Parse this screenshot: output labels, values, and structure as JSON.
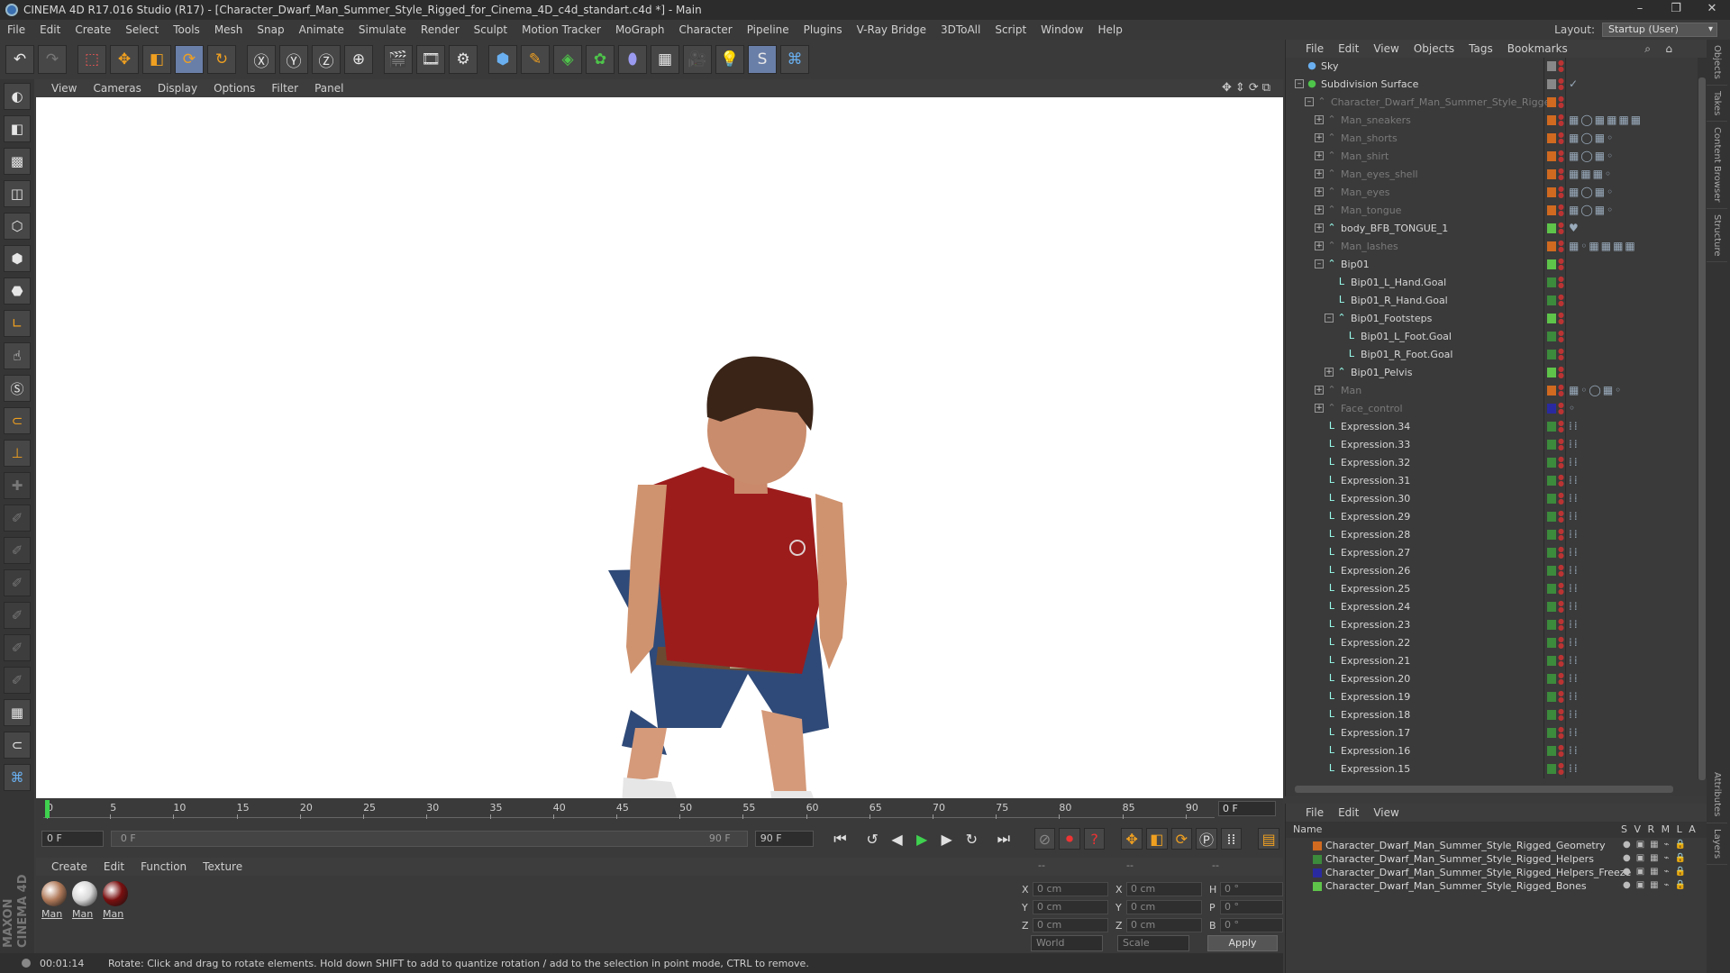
{
  "window": {
    "title": "CINEMA 4D R17.016 Studio (R17) - [Character_Dwarf_Man_Summer_Style_Rigged_for_Cinema_4D_c4d_standart.c4d *] - Main"
  },
  "menu": [
    "File",
    "Edit",
    "Create",
    "Select",
    "Tools",
    "Mesh",
    "Snap",
    "Animate",
    "Simulate",
    "Render",
    "Sculpt",
    "Motion Tracker",
    "MoGraph",
    "Character",
    "Pipeline",
    "Plugins",
    "V-Ray Bridge",
    "3DToAll",
    "Script",
    "Window",
    "Help"
  ],
  "layout": {
    "label": "Layout:",
    "value": "Startup (User)"
  },
  "viewport_menu": [
    "View",
    "Cameras",
    "Display",
    "Options",
    "Filter",
    "Panel"
  ],
  "timeline": {
    "ticks": [
      "0",
      "5",
      "10",
      "15",
      "20",
      "25",
      "30",
      "35",
      "40",
      "45",
      "50",
      "55",
      "60",
      "65",
      "70",
      "75",
      "80",
      "85",
      "90"
    ],
    "current_frame": "0 F"
  },
  "transport": {
    "start": "0 F",
    "range_start": "0 F",
    "range_end": "90 F",
    "end": "90 F"
  },
  "material_menu": [
    "Create",
    "Edit",
    "Function",
    "Texture"
  ],
  "materials": [
    {
      "name": "Man",
      "color": "#b07a5a"
    },
    {
      "name": "Man",
      "color": "#d8d8d8"
    },
    {
      "name": "Man",
      "color": "#7a1010"
    }
  ],
  "coords": {
    "rows": [
      {
        "a1": "X",
        "v1": "0 cm",
        "a2": "X",
        "v2": "0 cm",
        "a3": "H",
        "v3": "0 °"
      },
      {
        "a1": "Y",
        "v1": "0 cm",
        "a2": "Y",
        "v2": "0 cm",
        "a3": "P",
        "v3": "0 °"
      },
      {
        "a1": "Z",
        "v1": "0 cm",
        "a2": "Z",
        "v2": "0 cm",
        "a3": "B",
        "v3": "0 °"
      }
    ],
    "mode": "World",
    "scale": "Scale",
    "apply": "Apply",
    "header_left": "--",
    "header_mid": "--",
    "header_right": "--"
  },
  "status": {
    "time": "00:01:14",
    "message": "Rotate: Click and drag to rotate elements. Hold down SHIFT to add to quantize rotation / add to the selection in point mode, CTRL to remove."
  },
  "object_menu": [
    "File",
    "Edit",
    "View",
    "Objects",
    "Tags",
    "Bookmarks"
  ],
  "objects": [
    {
      "name": "Sky",
      "indent": 0,
      "dim": false,
      "layer": "#888888",
      "exp": "",
      "tags": ""
    },
    {
      "name": "Subdivision Surface",
      "indent": 0,
      "dim": false,
      "layer": "#888888",
      "exp": "-",
      "tags": "✓"
    },
    {
      "name": "Character_Dwarf_Man_Summer_Style_Rigged",
      "indent": 1,
      "dim": true,
      "layer": "#d06a20",
      "exp": "-",
      "tags": ""
    },
    {
      "name": "Man_sneakers",
      "indent": 2,
      "dim": true,
      "layer": "#d06a20",
      "exp": "+",
      "tags": "▦◯▦▦▦▦"
    },
    {
      "name": "Man_shorts",
      "indent": 2,
      "dim": true,
      "layer": "#d06a20",
      "exp": "+",
      "tags": "▦◯▦◦"
    },
    {
      "name": "Man_shirt",
      "indent": 2,
      "dim": true,
      "layer": "#d06a20",
      "exp": "+",
      "tags": "▦◯▦◦"
    },
    {
      "name": "Man_eyes_shell",
      "indent": 2,
      "dim": true,
      "layer": "#d06a20",
      "exp": "+",
      "tags": "▦▦▦◦"
    },
    {
      "name": "Man_eyes",
      "indent": 2,
      "dim": true,
      "layer": "#d06a20",
      "exp": "+",
      "tags": "▦◯▦◦"
    },
    {
      "name": "Man_tongue",
      "indent": 2,
      "dim": true,
      "layer": "#d06a20",
      "exp": "+",
      "tags": "▦◯▦◦"
    },
    {
      "name": "body_BFB_TONGUE_1",
      "indent": 2,
      "dim": false,
      "layer": "#5ec44a",
      "exp": "+",
      "tags": "♥"
    },
    {
      "name": "Man_lashes",
      "indent": 2,
      "dim": true,
      "layer": "#d06a20",
      "exp": "+",
      "tags": "▦◦▦▦▦▦"
    },
    {
      "name": "Bip01",
      "indent": 2,
      "dim": false,
      "layer": "#5ec44a",
      "exp": "-",
      "tags": ""
    },
    {
      "name": "Bip01_L_Hand.Goal",
      "indent": 3,
      "dim": false,
      "layer": "#3c8a3c",
      "exp": "",
      "tags": ""
    },
    {
      "name": "Bip01_R_Hand.Goal",
      "indent": 3,
      "dim": false,
      "layer": "#3c8a3c",
      "exp": "",
      "tags": ""
    },
    {
      "name": "Bip01_Footsteps",
      "indent": 3,
      "dim": false,
      "layer": "#5ec44a",
      "exp": "-",
      "tags": ""
    },
    {
      "name": "Bip01_L_Foot.Goal",
      "indent": 4,
      "dim": false,
      "layer": "#3c8a3c",
      "exp": "",
      "tags": ""
    },
    {
      "name": "Bip01_R_Foot.Goal",
      "indent": 4,
      "dim": false,
      "layer": "#3c8a3c",
      "exp": "",
      "tags": ""
    },
    {
      "name": "Bip01_Pelvis",
      "indent": 3,
      "dim": false,
      "layer": "#5ec44a",
      "exp": "+",
      "tags": ""
    },
    {
      "name": "Man",
      "indent": 2,
      "dim": true,
      "layer": "#d06a20",
      "exp": "+",
      "tags": "▦◦◯▦◦"
    },
    {
      "name": "Face_control",
      "indent": 2,
      "dim": true,
      "layer": "#2a2aa0",
      "exp": "+",
      "tags": "◦"
    },
    {
      "name": "Expression.34",
      "indent": 2,
      "dim": false,
      "layer": "#3c8a3c",
      "exp": "",
      "tags": "⁞⁞"
    },
    {
      "name": "Expression.33",
      "indent": 2,
      "dim": false,
      "layer": "#3c8a3c",
      "exp": "",
      "tags": "⁞⁞"
    },
    {
      "name": "Expression.32",
      "indent": 2,
      "dim": false,
      "layer": "#3c8a3c",
      "exp": "",
      "tags": "⁞⁞"
    },
    {
      "name": "Expression.31",
      "indent": 2,
      "dim": false,
      "layer": "#3c8a3c",
      "exp": "",
      "tags": "⁞⁞"
    },
    {
      "name": "Expression.30",
      "indent": 2,
      "dim": false,
      "layer": "#3c8a3c",
      "exp": "",
      "tags": "⁞⁞"
    },
    {
      "name": "Expression.29",
      "indent": 2,
      "dim": false,
      "layer": "#3c8a3c",
      "exp": "",
      "tags": "⁞⁞"
    },
    {
      "name": "Expression.28",
      "indent": 2,
      "dim": false,
      "layer": "#3c8a3c",
      "exp": "",
      "tags": "⁞⁞"
    },
    {
      "name": "Expression.27",
      "indent": 2,
      "dim": false,
      "layer": "#3c8a3c",
      "exp": "",
      "tags": "⁞⁞"
    },
    {
      "name": "Expression.26",
      "indent": 2,
      "dim": false,
      "layer": "#3c8a3c",
      "exp": "",
      "tags": "⁞⁞"
    },
    {
      "name": "Expression.25",
      "indent": 2,
      "dim": false,
      "layer": "#3c8a3c",
      "exp": "",
      "tags": "⁞⁞"
    },
    {
      "name": "Expression.24",
      "indent": 2,
      "dim": false,
      "layer": "#3c8a3c",
      "exp": "",
      "tags": "⁞⁞"
    },
    {
      "name": "Expression.23",
      "indent": 2,
      "dim": false,
      "layer": "#3c8a3c",
      "exp": "",
      "tags": "⁞⁞"
    },
    {
      "name": "Expression.22",
      "indent": 2,
      "dim": false,
      "layer": "#3c8a3c",
      "exp": "",
      "tags": "⁞⁞"
    },
    {
      "name": "Expression.21",
      "indent": 2,
      "dim": false,
      "layer": "#3c8a3c",
      "exp": "",
      "tags": "⁞⁞"
    },
    {
      "name": "Expression.20",
      "indent": 2,
      "dim": false,
      "layer": "#3c8a3c",
      "exp": "",
      "tags": "⁞⁞"
    },
    {
      "name": "Expression.19",
      "indent": 2,
      "dim": false,
      "layer": "#3c8a3c",
      "exp": "",
      "tags": "⁞⁞"
    },
    {
      "name": "Expression.18",
      "indent": 2,
      "dim": false,
      "layer": "#3c8a3c",
      "exp": "",
      "tags": "⁞⁞"
    },
    {
      "name": "Expression.17",
      "indent": 2,
      "dim": false,
      "layer": "#3c8a3c",
      "exp": "",
      "tags": "⁞⁞"
    },
    {
      "name": "Expression.16",
      "indent": 2,
      "dim": false,
      "layer": "#3c8a3c",
      "exp": "",
      "tags": "⁞⁞"
    },
    {
      "name": "Expression.15",
      "indent": 2,
      "dim": false,
      "layer": "#3c8a3c",
      "exp": "",
      "tags": "⁞⁞"
    }
  ],
  "layer_menu": [
    "File",
    "Edit",
    "View"
  ],
  "layer_header": {
    "name": "Name",
    "cols": "S V R M L A"
  },
  "layers": [
    {
      "name": "Character_Dwarf_Man_Summer_Style_Rigged_Geometry",
      "color": "#d06a20"
    },
    {
      "name": "Character_Dwarf_Man_Summer_Style_Rigged_Helpers",
      "color": "#3c8a3c"
    },
    {
      "name": "Character_Dwarf_Man_Summer_Style_Rigged_Helpers_Freeze",
      "color": "#2a2aa0"
    },
    {
      "name": "Character_Dwarf_Man_Summer_Style_Rigged_Bones",
      "color": "#5ec44a"
    }
  ],
  "side_tabs": [
    "Objects",
    "Takes",
    "Content Browser",
    "Structure"
  ],
  "side_tabs_bottom": [
    "Attributes",
    "Layers"
  ],
  "brand": "MAXON CINEMA 4D"
}
